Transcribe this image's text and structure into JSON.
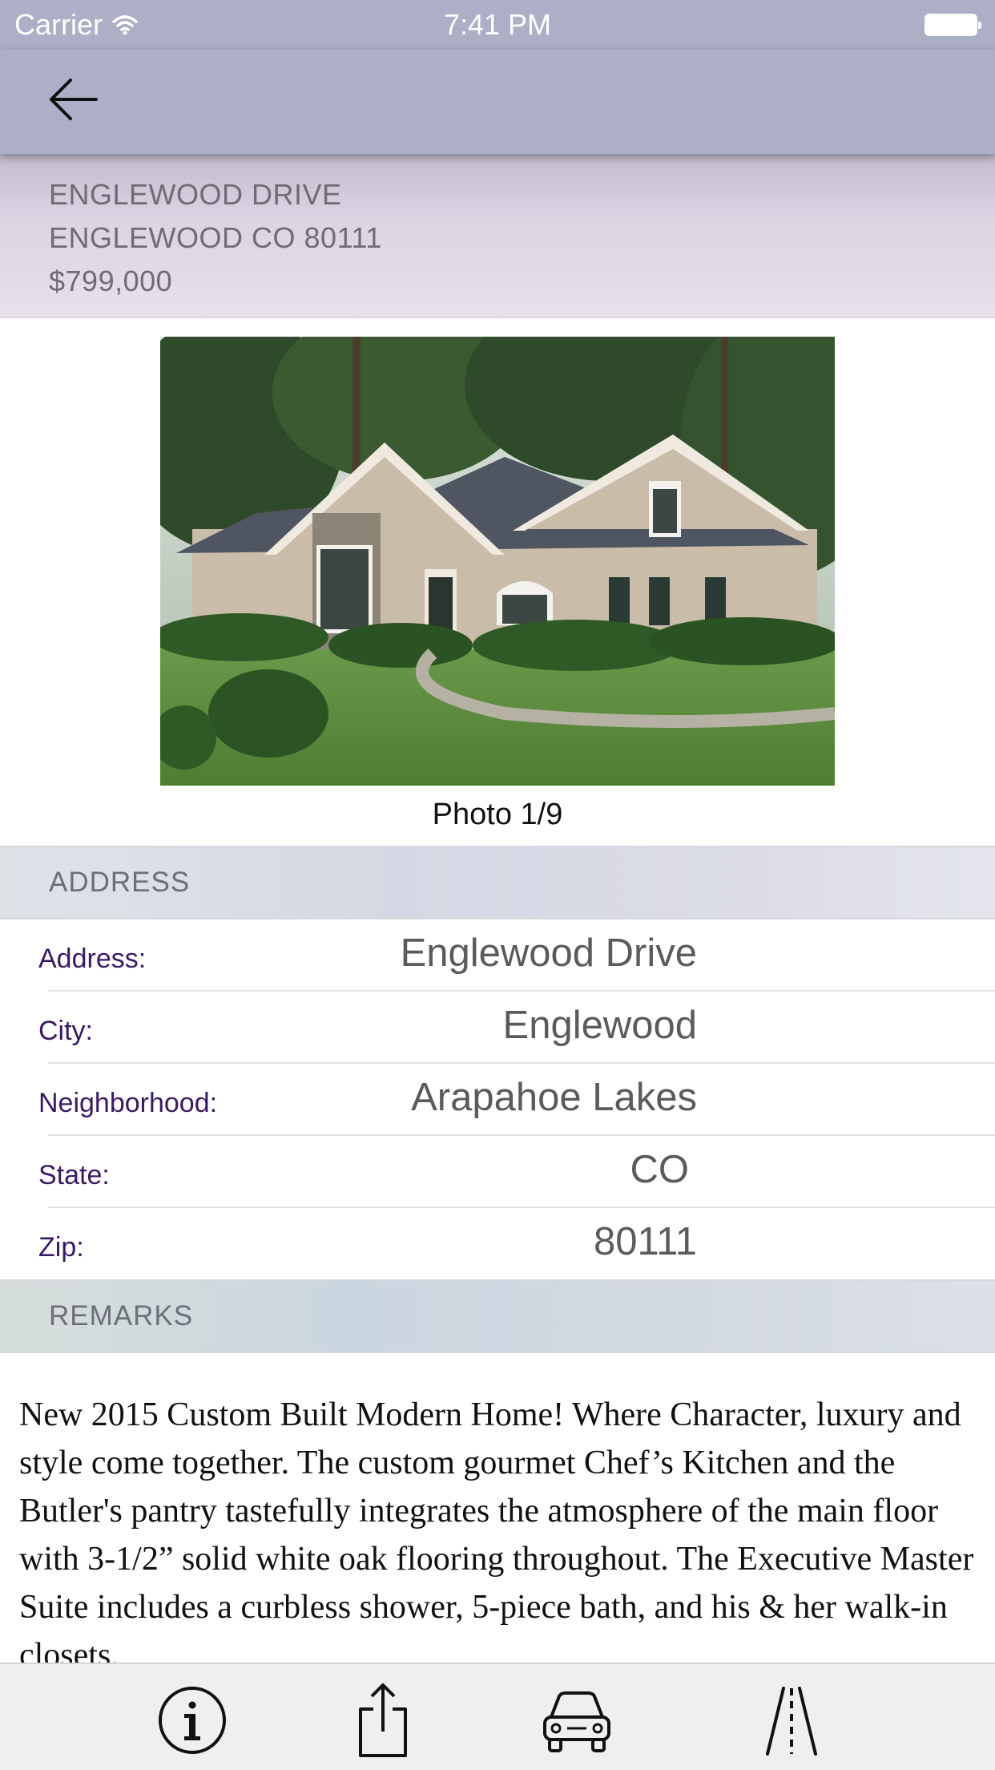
{
  "status_bar": {
    "carrier": "Carrier",
    "time": "7:41 PM"
  },
  "nav": {
    "back_icon": "back-arrow-icon"
  },
  "listing": {
    "street": "ENGLEWOOD DRIVE",
    "city_line": "ENGLEWOOD CO 80111",
    "price": "$799,000"
  },
  "photo": {
    "caption": "Photo 1/9",
    "current": 1,
    "total": 9
  },
  "address_section": {
    "title": "ADDRESS",
    "rows": [
      {
        "label": "Address:",
        "value": "Englewood Drive"
      },
      {
        "label": "City:",
        "value": "Englewood"
      },
      {
        "label": "Neighborhood:",
        "value": "Arapahoe Lakes"
      },
      {
        "label": "State:",
        "value": "CO"
      },
      {
        "label": "Zip:",
        "value": "80111"
      }
    ]
  },
  "remarks_section": {
    "title": "REMARKS",
    "text": "New 2015 Custom Built Modern Home! Where Character, luxury and style come together. The custom gourmet Chef’s Kitchen and the Butler's pantry tastefully integrates the atmosphere of the main floor with 3-1/2” solid white oak flooring throughout. The Executive Master Suite includes a curbless shower, 5-piece bath, and his & her walk-in closets."
  },
  "tab_bar": {
    "icons": [
      "info-icon",
      "share-icon",
      "car-icon",
      "road-icon"
    ]
  },
  "colors": {
    "nav_bg": "#adafc6",
    "label_purple": "#3a1a63",
    "value_gray": "#5b5b5e"
  }
}
